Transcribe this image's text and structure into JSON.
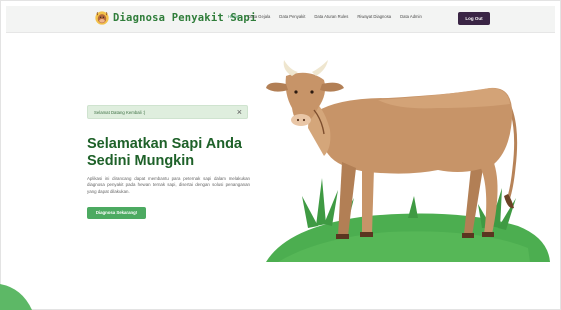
{
  "navbar": {
    "brand": "Diagnosa Penyakit Sapi",
    "links": [
      "Home",
      "Data Gejala",
      "Data Penyakit",
      "Data Aturan Rules",
      "Riwayat Diagnosa",
      "Data Admin"
    ],
    "logout_label": "Log Out"
  },
  "alert": {
    "message": "Selamat Datang Kembali :)",
    "close": "×"
  },
  "hero": {
    "title_line1": "Selamatkan Sapi Anda",
    "title_line2": "Sedini Mungkin",
    "description": "Aplikasi ini dirancang dapat membantu para peternak sapi dalam melakukan diagnosa penyakit pada hewan ternak sapi, disertai dengan solusi penanganan yang dapat dilakukan.",
    "cta_label": "Diagnosa Sekarang!"
  },
  "colors": {
    "brand_green": "#2f7d3a",
    "title_green": "#1e6129",
    "button_green": "#4caa61",
    "logout_bg": "#3a2545",
    "grass": "#4cae50"
  },
  "icons": {
    "brand_logo": "cow-face-icon",
    "alert_close": "close-icon"
  }
}
